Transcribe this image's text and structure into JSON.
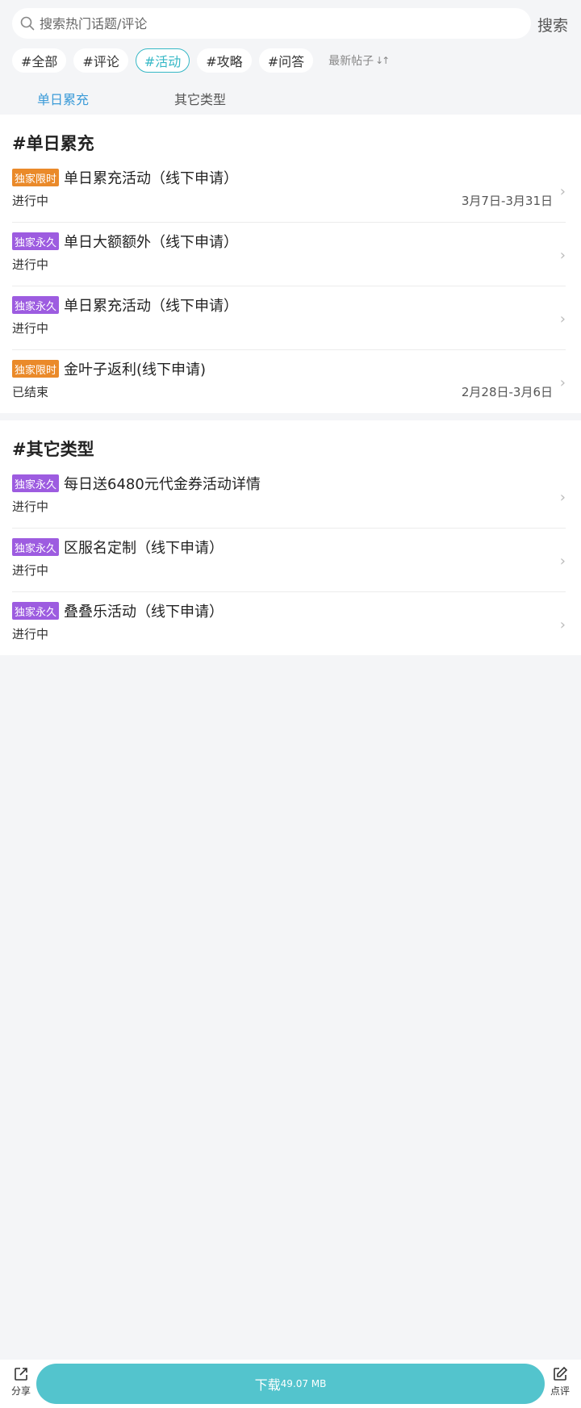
{
  "search": {
    "placeholder": "搜索热门话题/评论",
    "button": "搜索"
  },
  "tags": [
    "#全部",
    "#评论",
    "#活动",
    "#攻略",
    "#问答"
  ],
  "active_tag": "#活动",
  "sort_label": "最新帖子",
  "subtabs": [
    "单日累充",
    "其它类型"
  ],
  "sections": [
    {
      "title": "#单日累充",
      "items": [
        {
          "badge": "独家限时",
          "name": "单日累充活动（线下申请）",
          "status": "进行中",
          "date": "3月7日-3月31日"
        },
        {
          "badge": "独家永久",
          "name": "单日大额额外（线下申请）",
          "status": "进行中",
          "date": ""
        },
        {
          "badge": "独家永久",
          "name": "单日累充活动（线下申请）",
          "status": "进行中",
          "date": ""
        },
        {
          "badge": "独家限时",
          "name": "金叶子返利(线下申请)",
          "status": "已结束",
          "date": "2月28日-3月6日"
        }
      ]
    },
    {
      "title": "#其它类型",
      "items": [
        {
          "badge": "独家永久",
          "name": "每日送6480元代金券活动详情",
          "status": "进行中",
          "date": ""
        },
        {
          "badge": "独家永久",
          "name": "区服名定制（线下申请）",
          "status": "进行中",
          "date": ""
        },
        {
          "badge": "独家永久",
          "name": "叠叠乐活动（线下申请）",
          "status": "进行中",
          "date": ""
        }
      ]
    }
  ],
  "bottom": {
    "share": "分享",
    "download": "下载",
    "size": "49.07 MB",
    "review": "点评"
  },
  "colors": {
    "accent": "#53c4cd",
    "timed_badge": "#ea8a2a",
    "perm_badge": "#9d5ce0",
    "subtab_active": "#3b9bd8"
  }
}
